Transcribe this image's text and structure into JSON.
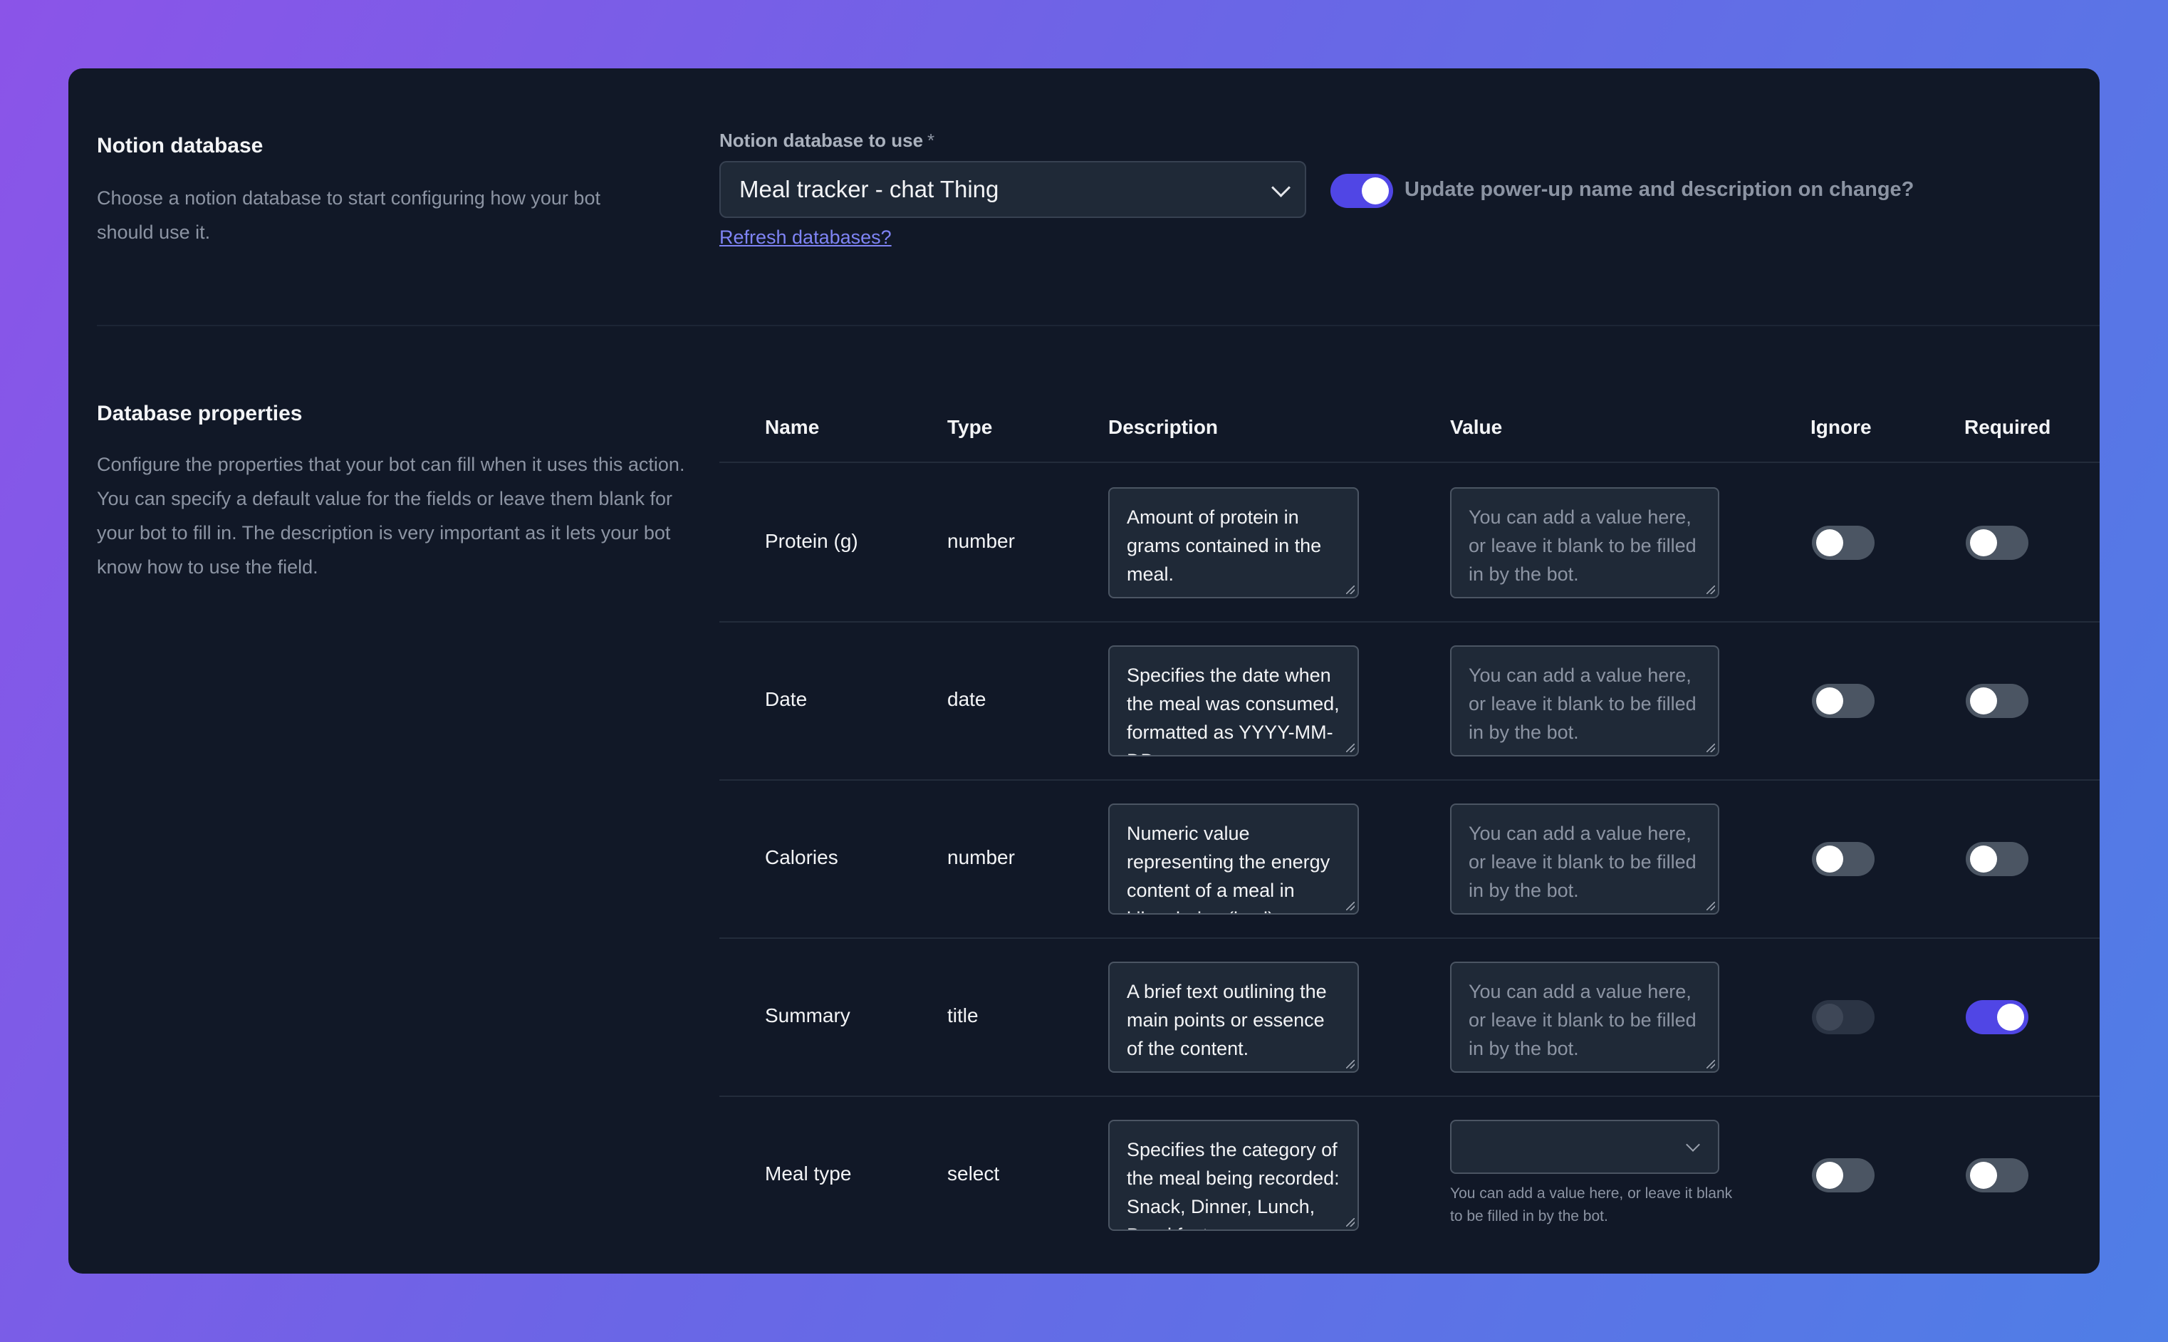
{
  "notion_section": {
    "title": "Notion database",
    "description": "Choose a notion database to start configuring how your bot should use it.",
    "field_label": "Notion database to use",
    "required_mark": "*",
    "selected_database": "Meal tracker - chat Thing",
    "refresh_link": "Refresh databases?",
    "update_toggle": {
      "label": "Update power-up name and description on change?",
      "on": true
    }
  },
  "properties_section": {
    "title": "Database properties",
    "description": "Configure the properties that your bot can fill when it uses this action. You can specify a default value for the fields or leave them blank for your bot to fill in. The description is very important as it lets your bot know how to use the field.",
    "columns": {
      "name": "Name",
      "type": "Type",
      "description": "Description",
      "value": "Value",
      "ignore": "Ignore",
      "required": "Required"
    },
    "value_placeholder": "You can add a value here, or leave it blank to be filled in by the bot.",
    "rows": [
      {
        "name": "Protein (g)",
        "type": "number",
        "description": "Amount of protein in grams contained in the meal.",
        "ignore": false,
        "required": false,
        "ignore_disabled": false
      },
      {
        "name": "Date",
        "type": "date",
        "description": "Specifies the date when the meal was consumed, formatted as YYYY-MM-DD.",
        "ignore": false,
        "required": false,
        "ignore_disabled": false
      },
      {
        "name": "Calories",
        "type": "number",
        "description": "Numeric value representing the energy content of a meal in kilocalories (kcal).",
        "ignore": false,
        "required": false,
        "ignore_disabled": false
      },
      {
        "name": "Summary",
        "type": "title",
        "description": "A brief text outlining the main points or essence of the content.",
        "ignore": false,
        "required": true,
        "ignore_disabled": true
      },
      {
        "name": "Meal type",
        "type": "select",
        "description": "Specifies the category of the meal being recorded: Snack, Dinner, Lunch, Breakfast.",
        "ignore": false,
        "required": false,
        "ignore_disabled": false,
        "value_is_select": true
      }
    ]
  },
  "colors": {
    "accent": "#5046e5",
    "panel": "#111827",
    "link": "#7f84f5"
  }
}
